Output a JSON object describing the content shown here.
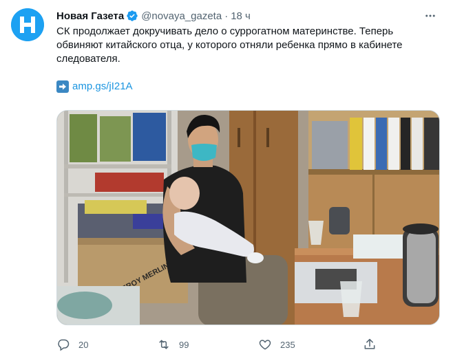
{
  "author": {
    "display_name": "Новая Газета",
    "handle": "@novaya_gazeta",
    "time": "18 ч",
    "avatar_letter": "Н"
  },
  "tweet": {
    "text": "СК продолжает докручивать дело о суррогатном материнстве. Теперь обвиняют китайского отца, у которого отняли ребенка прямо в кабинете следователя.",
    "link": "amp.gs/jI21A"
  },
  "media": {
    "box_brand_text": "LEROY MERLIN"
  },
  "actions": {
    "replies": "20",
    "retweets": "99",
    "likes": "235"
  },
  "icons": [
    "verified-icon",
    "more-icon",
    "arrow-right-icon",
    "reply-icon",
    "retweet-icon",
    "like-icon",
    "share-icon"
  ],
  "colors": {
    "avatar_blue": "#1da1f2",
    "link_blue": "#1b95e0",
    "muted": "#536471"
  }
}
